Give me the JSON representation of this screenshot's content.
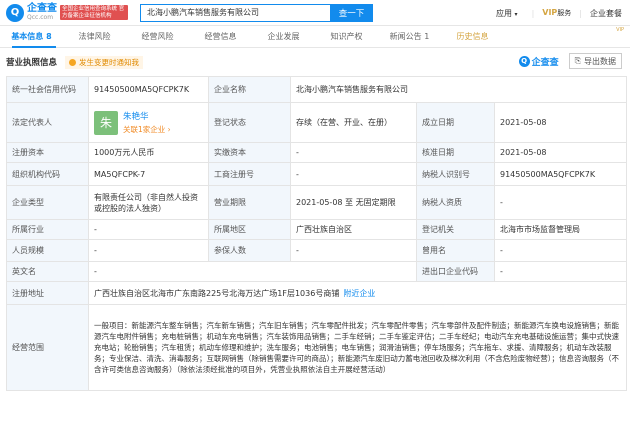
{
  "header": {
    "logo_char": "Q",
    "logo_name": "企查查",
    "logo_sub": "Qcc.com",
    "logo_badge": "全国企业信用查询系统 官方备案企业征信机构",
    "search_value": "北海小鹏汽车销售服务有限公司",
    "search_button": "查一下",
    "apps": "应用",
    "vip": "VIP",
    "vip_sub": "服务",
    "suite": "企业套餐"
  },
  "tabs": [
    {
      "label": "基本信息",
      "count": "8"
    },
    {
      "label": "法律风险",
      "count": ""
    },
    {
      "label": "经营风险",
      "count": ""
    },
    {
      "label": "经营信息",
      "count": ""
    },
    {
      "label": "企业发展",
      "count": ""
    },
    {
      "label": "知识产权",
      "count": ""
    },
    {
      "label": "新闻公告",
      "count": "1"
    },
    {
      "label": "历史信息",
      "count": ""
    }
  ],
  "tab_vip_mark": "VIP",
  "section": {
    "title": "营业执照信息",
    "note": "发生变更时通知我",
    "brand": "企查查",
    "brand_char": "Q",
    "export": "导出数据"
  },
  "info": {
    "credit_code_label": "统一社会信用代码",
    "credit_code": "91450500MA5QFCPK7K",
    "name_label": "企业名称",
    "name": "北海小鹏汽车销售服务有限公司",
    "legal_label": "法定代表人",
    "legal_avatar": "朱",
    "legal_name": "朱艳华",
    "legal_link": "关联1家企业",
    "legal_link_arrow": "›",
    "status_label": "登记状态",
    "status": "存续（在营、开业、在册）",
    "est_label": "成立日期",
    "est": "2021-05-08",
    "capital_label": "注册资本",
    "capital": "1000万元人民币",
    "paid_label": "实缴资本",
    "paid": "-",
    "approve_label": "核准日期",
    "approve": "2021-05-08",
    "org_label": "组织机构代码",
    "org": "MA5QFCPK-7",
    "reg_no_label": "工商注册号",
    "reg_no": "-",
    "tax_label": "纳税人识别号",
    "tax": "91450500MA5QFCPK7K",
    "type_label": "企业类型",
    "type": "有限责任公司（非自然人投资或控股的法人独资）",
    "term_label": "营业期限",
    "term": "2021-05-08 至 无固定期限",
    "taxq_label": "纳税人资质",
    "taxq": "-",
    "industry_label": "所属行业",
    "industry": "-",
    "region_label": "所属地区",
    "region": "广西壮族自治区",
    "authority_label": "登记机关",
    "authority": "北海市市场监督管理局",
    "staff_label": "人员规模",
    "staff": "-",
    "insured_label": "参保人数",
    "insured": "-",
    "former_label": "曾用名",
    "former": "-",
    "en_label": "英文名",
    "en": "-",
    "ie_label": "进出口企业代码",
    "ie": "-",
    "addr_label": "注册地址",
    "addr": "广西壮族自治区北海市广东南路225号北海万达广场1F层1036号商铺",
    "addr_link": "附近企业",
    "scope_label": "经营范围",
    "scope": "一般项目：新能源汽车整车销售；汽车新车销售；汽车旧车销售；汽车零配件批发；汽车零配件零售；汽车零部件及配件制造；新能源汽车换电设施销售；新能源汽车电附件销售；充电桩销售；机动车充电销售；汽车装饰用品销售；二手车经销；二手车鉴定评估；二手车经纪；电动汽车充电基础设施运营；集中式快速充电站；轮胎销售；汽车租赁；机动车修理和维护；洗车服务；电池销售；电车销售；润滑油销售；停车场服务；汽车拖车、求援、清障服务；机动车改装服务；专业保洁、清洗、消毒服务；互联网销售（除销售需要许可的商品）；新能源汽车废旧动力蓄电池回收及梯次利用（不含危险废物经营）；信息咨询服务（不含许可类信息咨询服务）（除依法须经批准的项目外，凭营业执照依法自主开展经营活动）"
  }
}
